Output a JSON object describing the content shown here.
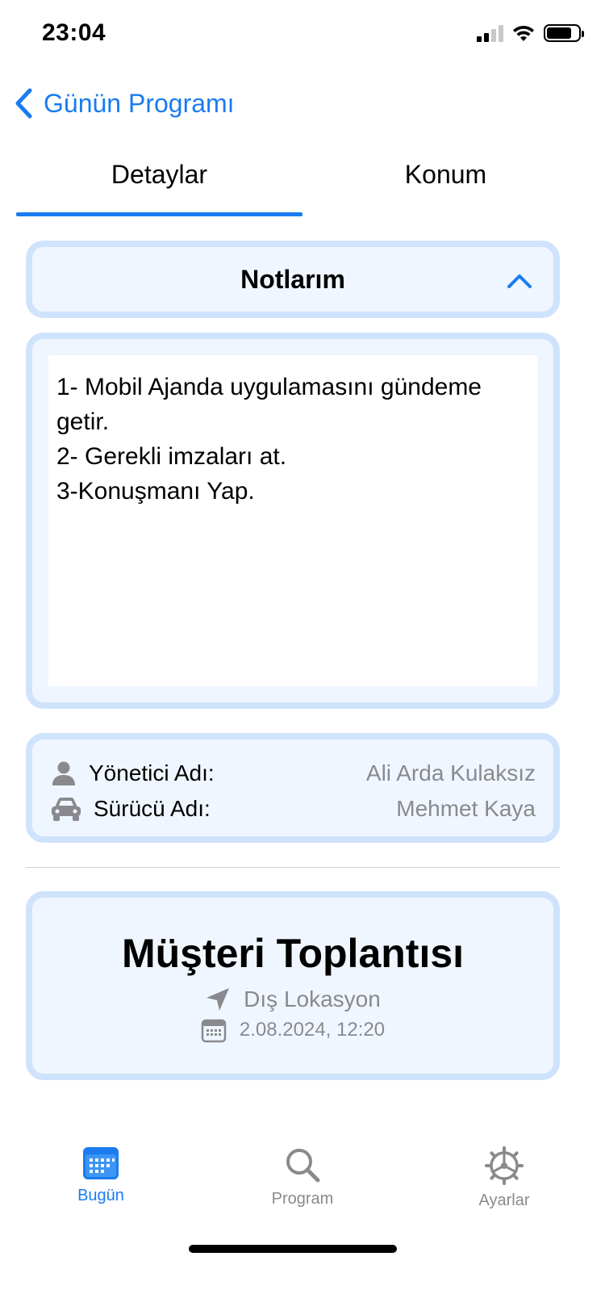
{
  "status_bar": {
    "time": "23:04"
  },
  "nav": {
    "back_label": "Günün Programı"
  },
  "tabs": [
    {
      "label": "Detaylar",
      "active": true
    },
    {
      "label": "Konum",
      "active": false
    }
  ],
  "notes": {
    "title": "Notlarım",
    "text": "1- Mobil Ajanda uygulamasını gündeme getir.\n2- Gerekli imzaları at.\n3-Konuşmanı Yap."
  },
  "info": {
    "manager_label": "Yönetici Adı:",
    "manager_value": "Ali Arda Kulaksız",
    "driver_label": "Sürücü Adı:",
    "driver_value": "Mehmet Kaya"
  },
  "event": {
    "title": "Müşteri Toplantısı",
    "location": "Dış Lokasyon",
    "datetime": "2.08.2024, 12:20"
  },
  "tab_bar": [
    {
      "label": "Bugün",
      "icon": "calendar-icon",
      "active": true
    },
    {
      "label": "Program",
      "icon": "search-icon",
      "active": false
    },
    {
      "label": "Ayarlar",
      "icon": "gear-icon",
      "active": false
    }
  ],
  "colors": {
    "accent": "#1a7cf0",
    "card_background": "#f0f6ff",
    "card_border": "#cfe3fd",
    "secondary_text": "#8a8a8e"
  }
}
